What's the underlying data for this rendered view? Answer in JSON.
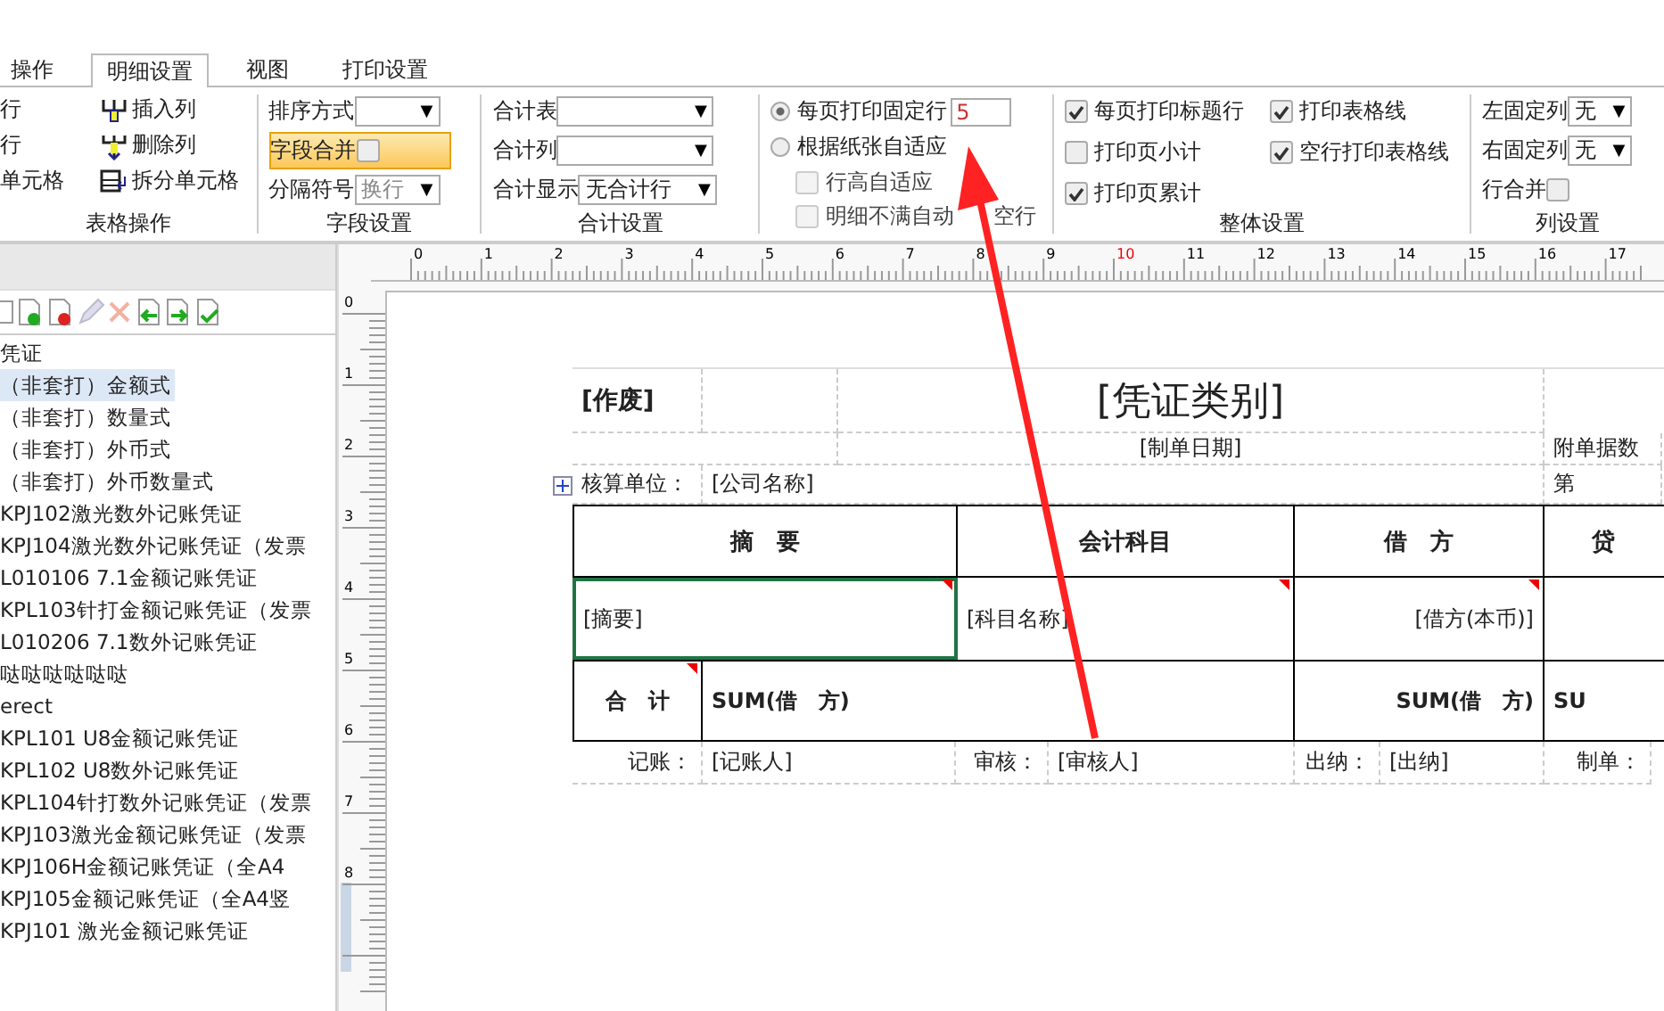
{
  "tabs": [
    {
      "label": "操作",
      "selected": false
    },
    {
      "label": "明细设置",
      "selected": true
    },
    {
      "label": "视图",
      "selected": false
    },
    {
      "label": "打印设置",
      "selected": false
    }
  ],
  "ribbon": {
    "table_ops": {
      "left": [
        "行",
        "行",
        "单元格"
      ],
      "right": [
        {
          "label": "插入列",
          "kind": "insert"
        },
        {
          "label": "删除列",
          "kind": "delete"
        },
        {
          "label": "拆分单元格",
          "kind": "split"
        }
      ],
      "label": "表格操作"
    },
    "field_settings": {
      "sort_label": "排序方式",
      "sort_arrow": "▼",
      "separator_arrow": "▼",
      "merge": {
        "label": "字段合并",
        "checked": false,
        "hovered": true
      },
      "separator_label": "分隔符号",
      "separator_value": "换行",
      "separator_disabled": true,
      "label": "字段设置"
    },
    "sum_settings": {
      "table_arrow": "▼",
      "column_arrow": "▼",
      "display_arrow": "▼",
      "table_label": "合计表",
      "column_label": "合计列",
      "display_label": "合计显示",
      "display_value": "无合计行",
      "label": "合计设置"
    },
    "rows": {
      "fixed": {
        "label": "每页打印固定行",
        "selected": true,
        "value": "5"
      },
      "auto": {
        "label": "根据纸张自适应",
        "selected": false
      },
      "options": [
        {
          "label": "行高自适应",
          "checked": false,
          "disabled": true
        },
        {
          "label": "明细不满自动",
          "label_after": "空行",
          "checked": false,
          "disabled": true
        }
      ]
    },
    "overall": {
      "options": [
        {
          "label": "每页打印标题行",
          "checked": true
        },
        {
          "label": "打印表格线",
          "checked": true
        },
        {
          "label": "打印页小计",
          "checked": false
        },
        {
          "label": "空行打印表格线",
          "checked": true
        },
        {
          "label": "打印页累计",
          "checked": true
        }
      ],
      "label": "整体设置"
    },
    "columns": {
      "left_arrow": "▼",
      "right_arrow": "▼",
      "left_label": "左固定列",
      "left_value": "无",
      "right_label": "右固定列",
      "right_value": "无",
      "merge_label": "行合并",
      "merge_checked": false,
      "label": "列设置"
    }
  },
  "sidebar": {
    "items": [
      {
        "label": "凭证",
        "selected": false
      },
      {
        "label": "（非套打）金额式",
        "selected": true
      },
      {
        "label": "（非套打）数量式",
        "selected": false
      },
      {
        "label": "（非套打）外币式",
        "selected": false
      },
      {
        "label": "（非套打）外币数量式",
        "selected": false
      },
      {
        "label": "KPJ102激光数外记账凭证",
        "selected": false
      },
      {
        "label": "KPJ104激光数外记账凭证（发票",
        "selected": false
      },
      {
        "label": "L010106 7.1金额记账凭证",
        "selected": false
      },
      {
        "label": "KPL103针打金额记账凭证（发票",
        "selected": false
      },
      {
        "label": "L010206 7.1数外记账凭证",
        "selected": false
      },
      {
        "label": "哒哒哒哒哒哒",
        "selected": false
      },
      {
        "label": "erect",
        "selected": false
      },
      {
        "label": "KPL101 U8金额记账凭证",
        "selected": false
      },
      {
        "label": "KPL102 U8数外记账凭证",
        "selected": false
      },
      {
        "label": "KPL104针打数外记账凭证（发票",
        "selected": false
      },
      {
        "label": "KPJ103激光金额记账凭证（发票",
        "selected": false
      },
      {
        "label": "KPJ106H金额记账凭证（全A4",
        "selected": false
      },
      {
        "label": "KPJ105金额记账凭证（全A4竖",
        "selected": false
      },
      {
        "label": "KPJ101 激光金额记账凭证",
        "selected": false
      }
    ]
  },
  "rulers": {
    "horizontal": [
      {
        "label": "0",
        "current": false
      },
      {
        "label": "1",
        "current": false
      },
      {
        "label": "2",
        "current": false
      },
      {
        "label": "3",
        "current": false
      },
      {
        "label": "4",
        "current": false
      },
      {
        "label": "5",
        "current": false
      },
      {
        "label": "6",
        "current": false
      },
      {
        "label": "7",
        "current": false
      },
      {
        "label": "8",
        "current": false
      },
      {
        "label": "9",
        "current": false
      },
      {
        "label": "10",
        "current": true
      },
      {
        "label": "11",
        "current": false
      },
      {
        "label": "12",
        "current": false
      },
      {
        "label": "13",
        "current": false
      },
      {
        "label": "14",
        "current": false
      },
      {
        "label": "15",
        "current": false
      },
      {
        "label": "16",
        "current": false
      },
      {
        "label": "17",
        "current": false
      }
    ],
    "vertical": [
      "0",
      "1",
      "2",
      "3",
      "4",
      "5",
      "6",
      "7",
      "8"
    ]
  },
  "report": {
    "void_mark": "[作废]",
    "title": "[凭证类别]",
    "date": "[制单日期]",
    "attachments_label": "附单据数",
    "unit_label": "核算单位：",
    "unit_value": "[公司名称]",
    "voucher_no_label": "第",
    "headers": [
      "摘　要",
      "会计科目",
      "借　方",
      "贷"
    ],
    "detail_row": [
      {
        "text": "[摘要]",
        "selected": true
      },
      {
        "text": "[科目名称]",
        "selected": false
      },
      {
        "text": "[借方(本币)]",
        "selected": false
      }
    ],
    "total_label": "合　计",
    "totals": [
      "SUM(借　方)",
      "SUM(借　方)",
      "SU"
    ],
    "footer": [
      {
        "label": "记账：",
        "value": "[记账人]"
      },
      {
        "label": "审核：",
        "value": "[审核人]"
      },
      {
        "label": "出纳：",
        "value": "[出纳]"
      },
      {
        "label": "制单："
      }
    ]
  }
}
